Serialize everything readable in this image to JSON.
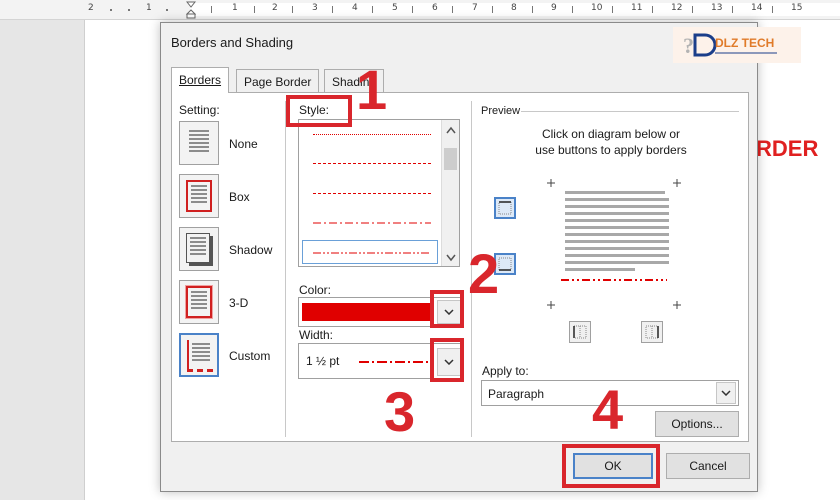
{
  "colors": {
    "accent": "#d9262c",
    "border_line": "#e00000",
    "selection": "#4a82c8"
  },
  "ruler": {
    "numbers": [
      "2",
      "1",
      "1",
      "2",
      "3",
      "4",
      "5",
      "6",
      "7",
      "8",
      "9",
      "10",
      "11",
      "12",
      "13",
      "14",
      "15"
    ]
  },
  "document": {
    "heading_fragment": "RDER"
  },
  "dialog": {
    "title": "Borders and Shading",
    "logo_text": "DLZ TECH",
    "tabs": [
      {
        "label": "Borders",
        "selected": true
      },
      {
        "label": "Page Border",
        "selected": false
      },
      {
        "label": "Shading",
        "selected": false
      }
    ],
    "setting": {
      "label": "Setting:",
      "options": [
        {
          "label": "None",
          "icon": "border-none-icon"
        },
        {
          "label": "Box",
          "icon": "border-box-icon"
        },
        {
          "label": "Shadow",
          "icon": "border-shadow-icon"
        },
        {
          "label": "3-D",
          "icon": "border-3d-icon"
        },
        {
          "label": "Custom",
          "icon": "border-custom-icon",
          "selected": true
        }
      ]
    },
    "style": {
      "label": "Style:",
      "options": [
        "dotted-fine",
        "dashed",
        "dashed-long",
        "dash-dot",
        "dash-dot-dot"
      ],
      "selected_index": 4
    },
    "color": {
      "label": "Color:",
      "value": "#e00000"
    },
    "width": {
      "label": "Width:",
      "value": "1 ½ pt"
    },
    "preview": {
      "label": "Preview",
      "help_line1": "Click on diagram below or",
      "help_line2": "use buttons to apply borders"
    },
    "apply_to": {
      "label": "Apply to:",
      "value": "Paragraph"
    },
    "buttons": {
      "options": "Options...",
      "ok": "OK",
      "cancel": "Cancel"
    }
  },
  "annotations": [
    "1",
    "2",
    "3",
    "4"
  ]
}
